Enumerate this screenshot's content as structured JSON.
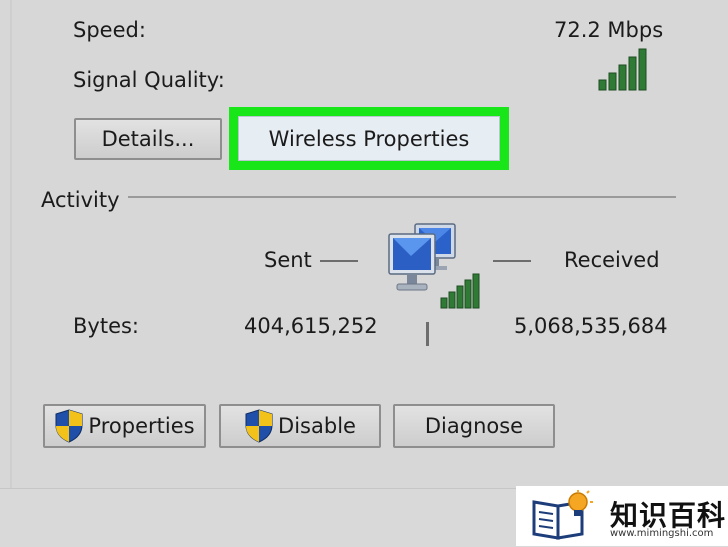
{
  "connection": {
    "speed_label": "Speed:",
    "speed_value": "72.2 Mbps",
    "signal_label": "Signal Quality:",
    "signal_bars": 5,
    "signal_level": 1.0
  },
  "buttons_top": {
    "details_label": "Details...",
    "wireless_properties_label": "Wireless Properties"
  },
  "activity": {
    "section_label": "Activity",
    "sent_label": "Sent",
    "received_label": "Received",
    "bytes_label": "Bytes:",
    "bytes_sent": "404,615,252",
    "bytes_received": "5,068,535,684"
  },
  "buttons_bottom": {
    "properties_label": "Properties",
    "disable_label": "Disable",
    "diagnose_label": "Diagnose"
  },
  "watermark": {
    "title": "知识百科",
    "url": "www.mimingshi.com"
  },
  "colors": {
    "highlight": "#19e619",
    "signal_green": "#2e7d32",
    "shield_blue": "#1f4fa8",
    "shield_yellow": "#f2c21b"
  }
}
